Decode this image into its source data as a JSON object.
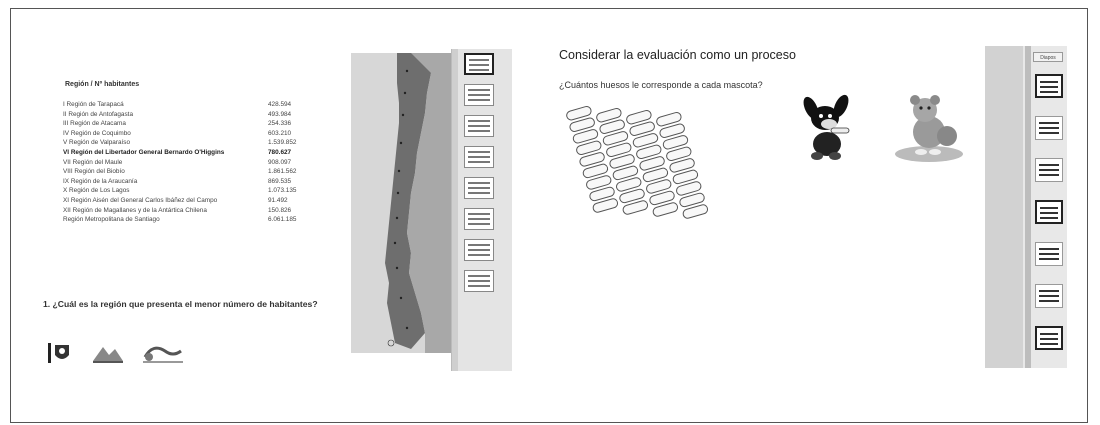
{
  "left_slide": {
    "table_title": "Región / Nº habitantes",
    "regions": [
      {
        "name": "I Región de Tarapacá",
        "value": "428.594",
        "bold": false
      },
      {
        "name": "II Región de Antofagasta",
        "value": "493.984",
        "bold": false
      },
      {
        "name": "III Región de Atacama",
        "value": "254.336",
        "bold": false
      },
      {
        "name": "IV Región de Coquimbo",
        "value": "603.210",
        "bold": false
      },
      {
        "name": "V Región de Valparaíso",
        "value": "1.539.852",
        "bold": false
      },
      {
        "name": "VI Región del Libertador General Bernardo O'Higgins",
        "value": "780.627",
        "bold": true
      },
      {
        "name": "VII Región del Maule",
        "value": "908.097",
        "bold": false
      },
      {
        "name": "VIII Región del Biobío",
        "value": "1.861.562",
        "bold": false
      },
      {
        "name": "IX Región de la Araucanía",
        "value": "869.535",
        "bold": false
      },
      {
        "name": "X Región de Los Lagos",
        "value": "1.073.135",
        "bold": false
      },
      {
        "name": "XI Región Aisén del General Carlos Ibáñez del Campo",
        "value": "91.492",
        "bold": false
      },
      {
        "name": "XII Región de Magallanes y de la Antártica Chilena",
        "value": "150.826",
        "bold": false
      },
      {
        "name": "Región Metropolitana de Santiago",
        "value": "6.061.185",
        "bold": false
      }
    ],
    "question": "1. ¿Cuál es la región que presenta el menor número de habitantes?",
    "thumbnail_count": 8
  },
  "right_slide": {
    "title": "Considerar la evaluación como un proceso",
    "subtitle": "¿Cuántos huesos le corresponde a cada mascota?",
    "thumbnail_header": "Diapos",
    "thumbnail_count": 7
  },
  "colors": {
    "frame": "#555555",
    "map_land": "#6e6e6e",
    "map_sea": "#bfbfbf",
    "pane": "#e4e4e4"
  },
  "icons": [
    "map-icon",
    "dog-icon",
    "teddy-bear-icon",
    "bone-icon",
    "logo-icon"
  ]
}
